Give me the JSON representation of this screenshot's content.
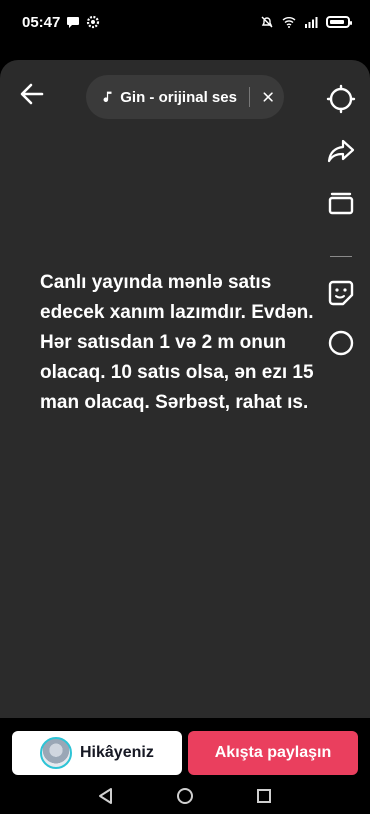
{
  "status": {
    "time": "05:47"
  },
  "top": {
    "sound_label": "Gin - orijinal ses"
  },
  "caption": {
    "lines": [
      "Canlı yayında mənlə satıs",
      "edecek xanım lazımdır. Evdən.",
      "Hər satısdan 1 və 2 m onun",
      "olacaq. 10 satıs olsa, ən ezı 15",
      "man olacaq. Sərbəst, rahat ıs."
    ]
  },
  "bottom": {
    "story_label": "Hikâyeniz",
    "share_label": "Akışta paylaşın"
  },
  "colors": {
    "editor_bg": "#2b2b2b",
    "share_button": "#ea3f5e",
    "avatar_ring": "#2ec4d6"
  }
}
